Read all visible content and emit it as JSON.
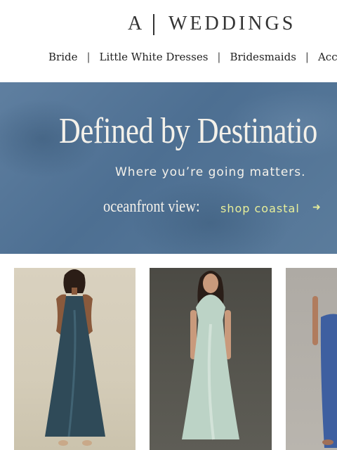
{
  "header": {
    "logo_left": "A",
    "logo_right": "WEDDINGS",
    "nav": [
      "Bride",
      "Little White Dresses",
      "Bridesmaids",
      "Acces"
    ]
  },
  "hero": {
    "title": "Defined by Destinatio",
    "subtitle": "Where you’re going matters.",
    "cta_label": "oceanfront view:",
    "cta_link": "shop coastal",
    "cta_arrow_icon": "arrow-right-icon",
    "colors": {
      "background": "#52739a",
      "text": "#f4f1ea",
      "link": "#e8ef9a"
    }
  },
  "products": [
    {
      "dress_color": "#2f4a58"
    },
    {
      "dress_color": "#bcd3c6"
    },
    {
      "dress_color": "#3e5fa0"
    }
  ]
}
